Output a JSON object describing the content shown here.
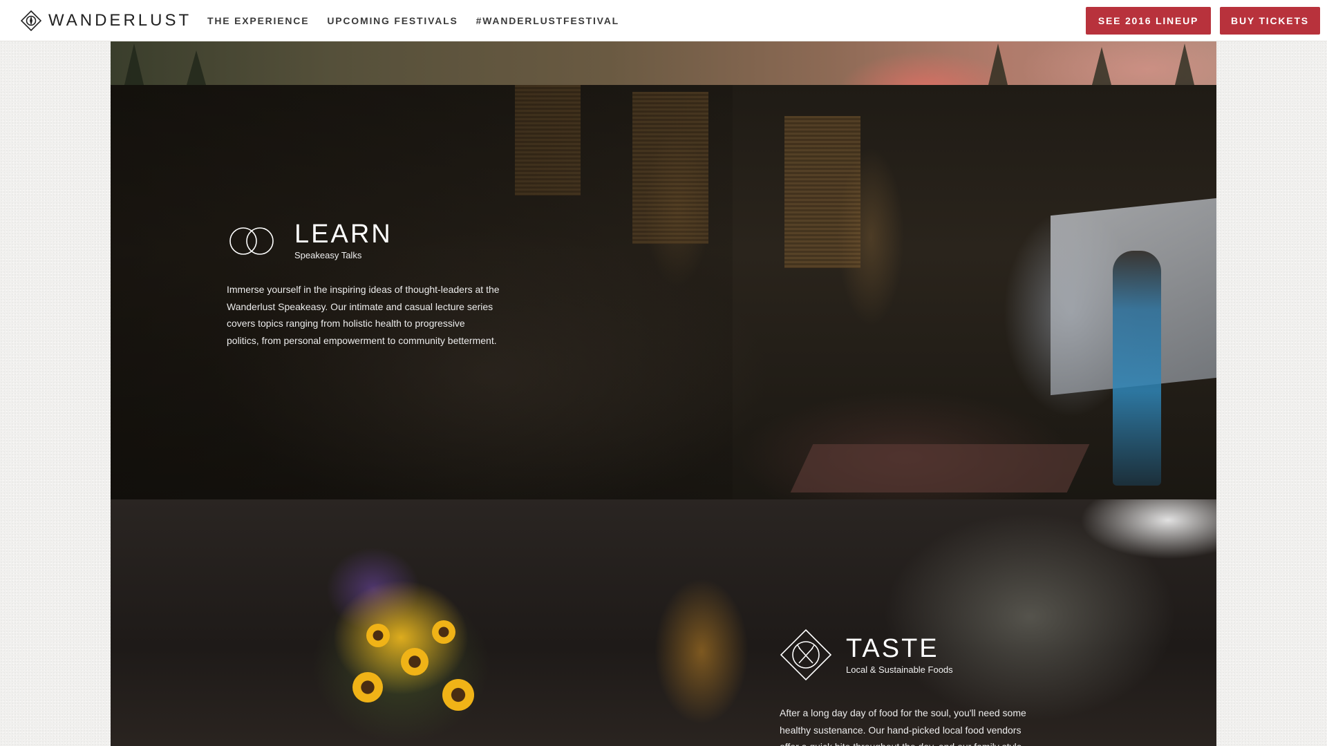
{
  "brand": {
    "name": "WANDERLUST",
    "logo_icon": "compass-diamond-icon"
  },
  "nav": {
    "items": [
      {
        "label": "THE EXPERIENCE"
      },
      {
        "label": "UPCOMING FESTIVALS"
      },
      {
        "label": "#WANDERLUSTFESTIVAL"
      }
    ]
  },
  "actions": {
    "lineup_label": "SEE 2016 LINEUP",
    "tickets_label": "BUY TICKETS",
    "accent_color": "#b8323c"
  },
  "sections": {
    "learn": {
      "icon": "two-circles-icon",
      "title": "LEARN",
      "subtitle": "Speakeasy Talks",
      "body": "Immerse yourself in the inspiring ideas of thought-leaders at the Wanderlust Speakeasy. Our intimate and casual lecture series covers topics ranging from holistic health to progressive politics, from personal empowerment to community betterment."
    },
    "taste": {
      "icon": "fork-knife-diamond-icon",
      "title": "TASTE",
      "subtitle": "Local & Sustainable Foods",
      "body": "After a long day day of food for the soul, you'll need some healthy sustenance. Our hand-picked local food vendors offer a quick bite throughout the day, and our family style,"
    }
  }
}
